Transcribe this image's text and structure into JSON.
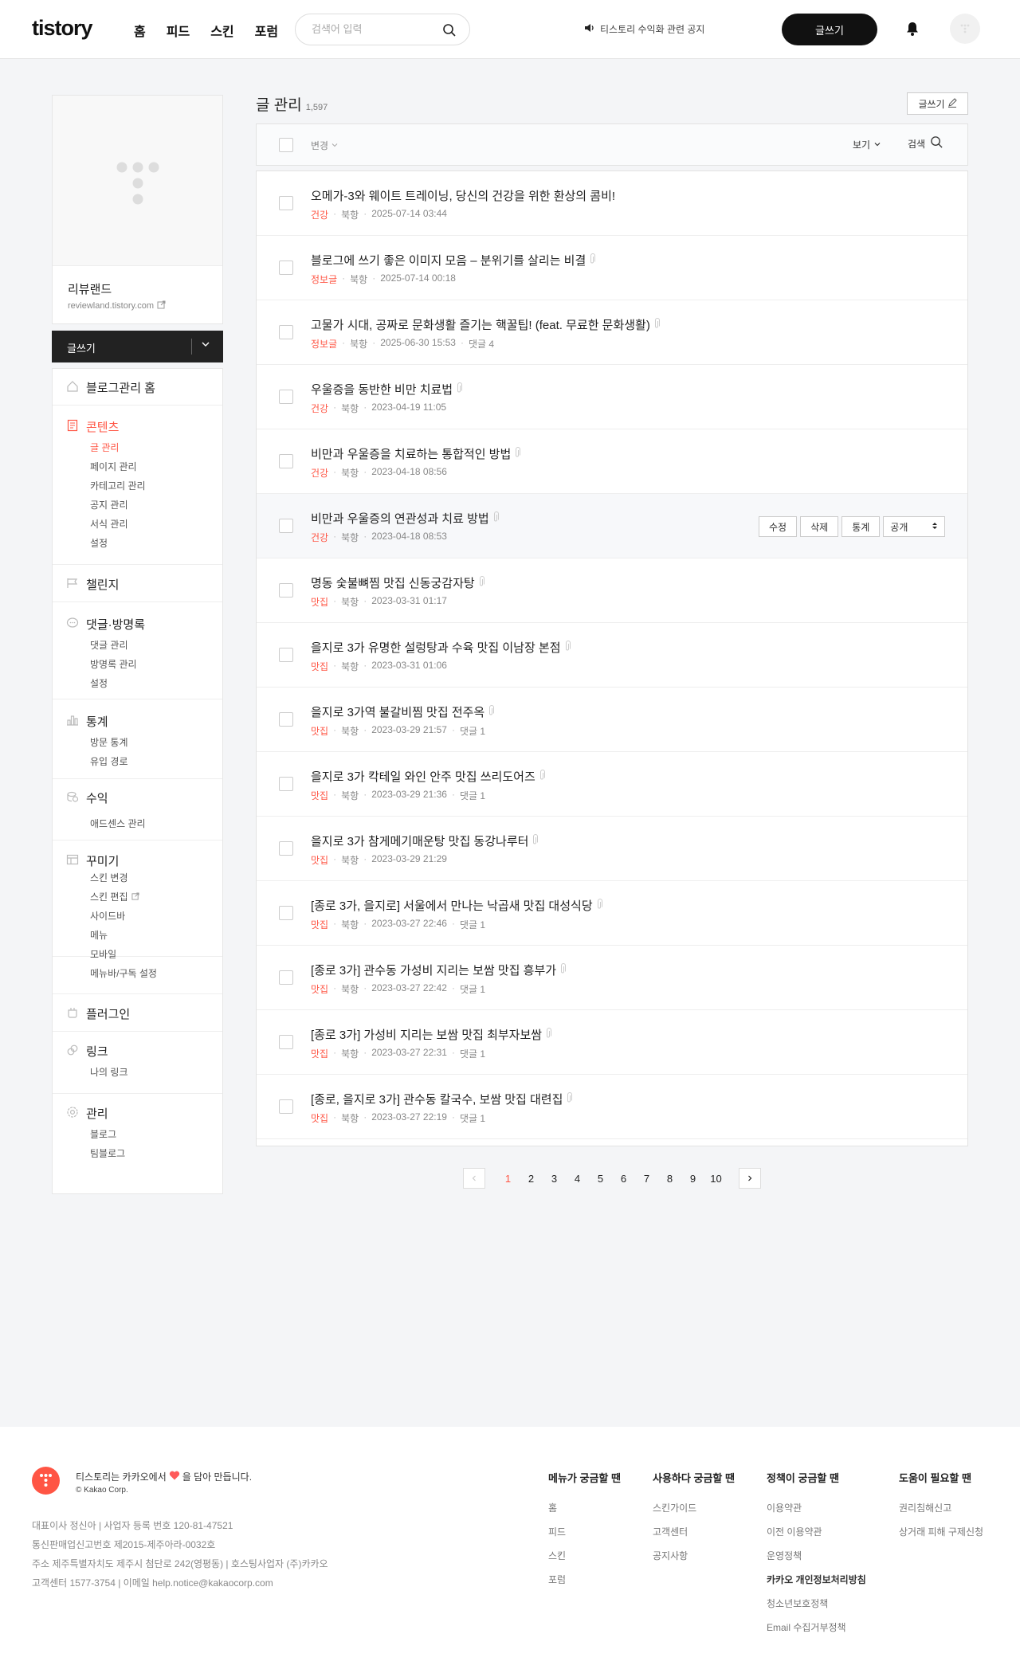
{
  "header": {
    "logo": "tistory",
    "nav": [
      "홈",
      "피드",
      "스킨",
      "포럼"
    ],
    "search_placeholder": "검색어 입력",
    "notice": "티스토리 수익화 관련 공지",
    "write": "글쓰기"
  },
  "sidebar": {
    "blog_name": "리뷰랜드",
    "blog_url": "reviewland.tistory.com",
    "write": "글쓰기",
    "menu": {
      "home": "블로그관리 홈",
      "contents": {
        "label": "콘텐츠",
        "items": [
          "글 관리",
          "페이지 관리",
          "카테고리 관리",
          "공지 관리",
          "서식 관리",
          "설정"
        ]
      },
      "challenge": "챌린지",
      "comments": {
        "label": "댓글·방명록",
        "items": [
          "댓글 관리",
          "방명록 관리",
          "설정"
        ]
      },
      "stats": {
        "label": "통계",
        "items": [
          "방문 통계",
          "유입 경로"
        ]
      },
      "revenue": {
        "label": "수익",
        "items": [
          "애드센스 관리"
        ]
      },
      "decorate": {
        "label": "꾸미기",
        "items": [
          "스킨 변경",
          "스킨 편집",
          "사이드바",
          "메뉴",
          "모바일",
          "메뉴바/구독 설정"
        ]
      },
      "plugin": "플러그인",
      "link": {
        "label": "링크",
        "items": [
          "나의 링크"
        ]
      },
      "manage": {
        "label": "관리",
        "items": [
          "블로그",
          "팀블로그"
        ]
      }
    }
  },
  "main": {
    "title": "글 관리",
    "count": "1,597",
    "write": "글쓰기",
    "toolbar": {
      "change": "변경",
      "view": "보기",
      "search": "검색"
    },
    "row_actions": {
      "edit": "수정",
      "delete": "삭제",
      "stats": "통계",
      "visibility": "공개"
    },
    "posts": [
      {
        "title": "오메가-3와 웨이트 트레이닝, 당신의 건강을 위한 환상의 콤비!",
        "category": "건강",
        "author": "북항",
        "date": "2025-07-14 03:44",
        "comments": "",
        "clip": false
      },
      {
        "title": "블로그에 쓰기 좋은 이미지 모음 – 분위기를 살리는 비결",
        "category": "정보글",
        "author": "북항",
        "date": "2025-07-14 00:18",
        "comments": "",
        "clip": true
      },
      {
        "title": "고물가 시대, 공짜로 문화생활 즐기는 핵꿀팁! (feat. 무료한 문화생활)",
        "category": "정보글",
        "author": "북항",
        "date": "2025-06-30 15:53",
        "comments": "댓글 4",
        "clip": true
      },
      {
        "title": "우울증을 동반한 비만 치료법",
        "category": "건강",
        "author": "북항",
        "date": "2023-04-19 11:05",
        "comments": "",
        "clip": true
      },
      {
        "title": "비만과 우울증을 치료하는 통합적인 방법",
        "category": "건강",
        "author": "북항",
        "date": "2023-04-18 08:56",
        "comments": "",
        "clip": true
      },
      {
        "title": "비만과 우울증의 연관성과 치료 방법",
        "category": "건강",
        "author": "북항",
        "date": "2023-04-18 08:53",
        "comments": "",
        "clip": true
      },
      {
        "title": "명동 숯불뼈찜 맛집 신동궁감자탕",
        "category": "맛집",
        "author": "북항",
        "date": "2023-03-31 01:17",
        "comments": "",
        "clip": true
      },
      {
        "title": "을지로 3가 유명한 설렁탕과 수육 맛집 이남장 본점",
        "category": "맛집",
        "author": "북항",
        "date": "2023-03-31 01:06",
        "comments": "",
        "clip": true
      },
      {
        "title": "을지로 3가역 불갈비찜 맛집 전주옥",
        "category": "맛집",
        "author": "북항",
        "date": "2023-03-29 21:57",
        "comments": "댓글 1",
        "clip": true
      },
      {
        "title": "을지로 3가 칵테일 와인 안주 맛집 쓰리도어즈",
        "category": "맛집",
        "author": "북항",
        "date": "2023-03-29 21:36",
        "comments": "댓글 1",
        "clip": true
      },
      {
        "title": "을지로 3가 참게메기매운탕 맛집 동강나루터",
        "category": "맛집",
        "author": "북항",
        "date": "2023-03-29 21:29",
        "comments": "",
        "clip": true
      },
      {
        "title": "[종로 3가, 을지로] 서울에서 만나는 낙곱새 맛집 대성식당",
        "category": "맛집",
        "author": "북항",
        "date": "2023-03-27 22:46",
        "comments": "댓글 1",
        "clip": true
      },
      {
        "title": "[종로 3가] 관수동 가성비 지리는 보쌈 맛집 흥부가",
        "category": "맛집",
        "author": "북항",
        "date": "2023-03-27 22:42",
        "comments": "댓글 1",
        "clip": true
      },
      {
        "title": "[종로 3가] 가성비 지리는 보쌈 맛집 최부자보쌈",
        "category": "맛집",
        "author": "북항",
        "date": "2023-03-27 22:31",
        "comments": "댓글 1",
        "clip": true
      },
      {
        "title": "[종로, 을지로 3가] 관수동 칼국수, 보쌈 맛집 대련집",
        "category": "맛집",
        "author": "북항",
        "date": "2023-03-27 22:19",
        "comments": "댓글 1",
        "clip": true
      }
    ],
    "pages": [
      "1",
      "2",
      "3",
      "4",
      "5",
      "6",
      "7",
      "8",
      "9",
      "10"
    ],
    "current_page": "1"
  },
  "footer": {
    "brand_pre": "티스토리는 카카오에서",
    "brand_post": "을 담아 만듭니다.",
    "copyright": "© Kakao Corp.",
    "info": [
      "대표이사 정신아  |  사업자 등록 번호 120-81-47521",
      "통신판매업신고번호 제2015-제주아라-0032호",
      "주소 제주특별자치도 제주시 첨단로 242(영평동)  |  호스팅사업자 (주)카카오",
      "고객센터 1577-3754  |  이메일 help.notice@kakaocorp.com"
    ],
    "columns": [
      {
        "title": "메뉴가 궁금할 땐",
        "links": [
          "홈",
          "피드",
          "스킨",
          "포럼"
        ]
      },
      {
        "title": "사용하다 궁금할 땐",
        "links": [
          "스킨가이드",
          "고객센터",
          "공지사항"
        ]
      },
      {
        "title": "정책이 궁금할 땐",
        "links": [
          "이용약관",
          "이전 이용약관",
          "운영정책",
          "카카오 개인정보처리방침",
          "청소년보호정책",
          "Email 수집거부정책"
        ]
      },
      {
        "title": "도움이 필요할 땐",
        "links": [
          "권리침해신고",
          "상거래 피해 구제신청"
        ]
      }
    ]
  },
  "colors": {
    "accent": "#ff5544",
    "dark": "#111111",
    "background": "#f4f5f7"
  }
}
